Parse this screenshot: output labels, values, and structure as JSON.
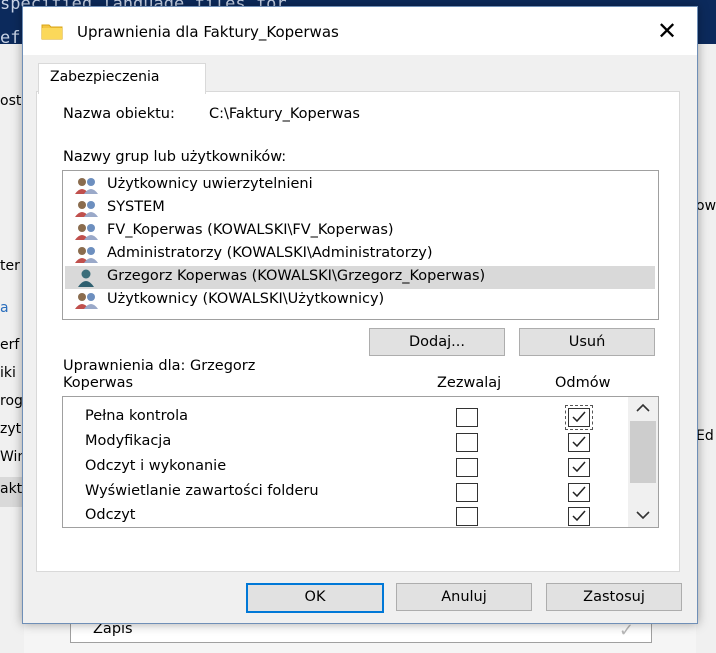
{
  "background": {
    "console_lines": [
      "specified language files for",
      "   e",
      "ef"
    ],
    "left_fragments": [
      "ost",
      "ter",
      "a",
      "erf",
      "iki",
      "rog",
      "zyt",
      "Win",
      "akt"
    ],
    "right_fragments": [
      "ow",
      "Ed"
    ],
    "zapis_label": "Zapis"
  },
  "dialog": {
    "title": "Uprawnienia dla Faktury_Koperwas",
    "close_glyph": "✕",
    "tab_label": "Zabezpieczenia",
    "object_label": "Nazwa obiektu:",
    "object_value": "C:\\Faktury_Koperwas",
    "groups_label": "Nazwy grup lub użytkowników:",
    "users": [
      {
        "name": "Użytkownicy uwierzytelnieni",
        "icon": "group-icon",
        "selected": false
      },
      {
        "name": "SYSTEM",
        "icon": "group-icon",
        "selected": false
      },
      {
        "name": "FV_Koperwas (KOWALSKI\\FV_Koperwas)",
        "icon": "group-icon",
        "selected": false
      },
      {
        "name": "Administratorzy (KOWALSKI\\Administratorzy)",
        "icon": "group-icon",
        "selected": false
      },
      {
        "name": "Grzegorz Koperwas (KOWALSKI\\Grzegorz_Koperwas)",
        "icon": "user-icon",
        "selected": true
      },
      {
        "name": "Użytkownicy (KOWALSKI\\Użytkownicy)",
        "icon": "group-icon",
        "selected": false
      }
    ],
    "add_label": "Dodaj...",
    "remove_label": "Usuń",
    "perm_for_line1": "Uprawnienia dla: Grzegorz",
    "perm_for_line2": "Koperwas",
    "allow_header": "Zezwalaj",
    "deny_header": "Odmów",
    "permissions": [
      {
        "name": "Pełna kontrola",
        "allow": false,
        "deny": true
      },
      {
        "name": "Modyfikacja",
        "allow": false,
        "deny": true
      },
      {
        "name": "Odczyt i wykonanie",
        "allow": false,
        "deny": true
      },
      {
        "name": "Wyświetlanie zawartości folderu",
        "allow": false,
        "deny": true
      },
      {
        "name": "Odczyt",
        "allow": false,
        "deny": true
      }
    ],
    "ok_label": "OK",
    "cancel_label": "Anuluj",
    "apply_label": "Zastosuj"
  }
}
